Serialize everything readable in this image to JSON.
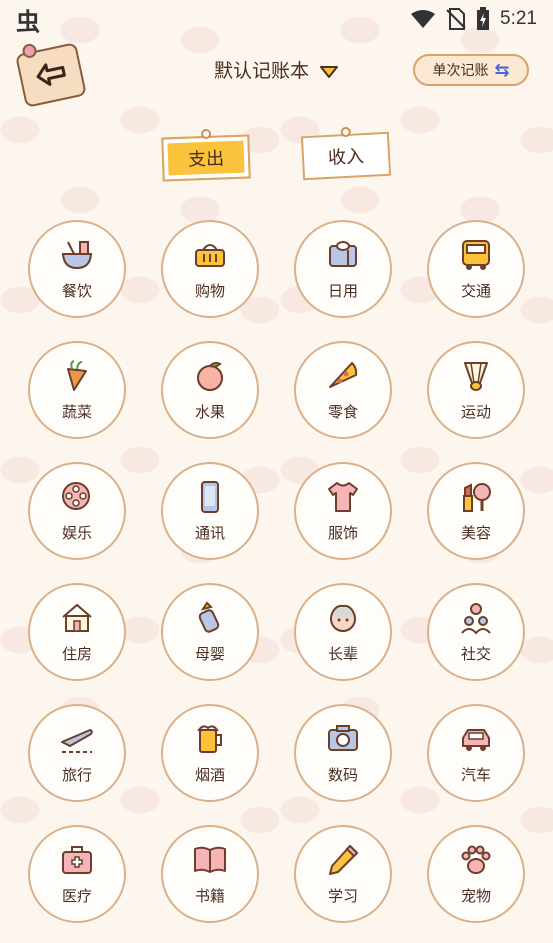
{
  "status": {
    "app_glyph": "虫",
    "time": "5:21"
  },
  "header": {
    "title": "默认记账本",
    "single_label": "单次记账",
    "swap_symbol": "⇆"
  },
  "tabs": [
    {
      "label": "支出"
    },
    {
      "label": "收入"
    }
  ],
  "categories": [
    {
      "label": "餐饮",
      "icon": "bowl-icon"
    },
    {
      "label": "购物",
      "icon": "basket-icon"
    },
    {
      "label": "日用",
      "icon": "tissue-icon"
    },
    {
      "label": "交通",
      "icon": "bus-icon"
    },
    {
      "label": "蔬菜",
      "icon": "carrot-icon"
    },
    {
      "label": "水果",
      "icon": "peach-icon"
    },
    {
      "label": "零食",
      "icon": "pizza-icon"
    },
    {
      "label": "运动",
      "icon": "shuttlecock-icon"
    },
    {
      "label": "娱乐",
      "icon": "film-reel-icon"
    },
    {
      "label": "通讯",
      "icon": "phone-icon"
    },
    {
      "label": "服饰",
      "icon": "shirt-icon"
    },
    {
      "label": "美容",
      "icon": "lipstick-icon"
    },
    {
      "label": "住房",
      "icon": "house-icon"
    },
    {
      "label": "母婴",
      "icon": "baby-bottle-icon"
    },
    {
      "label": "长辈",
      "icon": "grandma-icon"
    },
    {
      "label": "社交",
      "icon": "people-icon"
    },
    {
      "label": "旅行",
      "icon": "airplane-icon"
    },
    {
      "label": "烟酒",
      "icon": "beer-icon"
    },
    {
      "label": "数码",
      "icon": "camera-icon"
    },
    {
      "label": "汽车",
      "icon": "car-icon"
    },
    {
      "label": "医疗",
      "icon": "medkit-icon"
    },
    {
      "label": "书籍",
      "icon": "book-icon"
    },
    {
      "label": "学习",
      "icon": "pencil-icon"
    },
    {
      "label": "宠物",
      "icon": "paw-icon"
    }
  ],
  "colors": {
    "accent": "#fbc23c",
    "border": "#d9b08a",
    "icon_brown": "#8b5a3c",
    "icon_pink": "#f4b4b8",
    "swap_blue": "#4b64d6"
  }
}
